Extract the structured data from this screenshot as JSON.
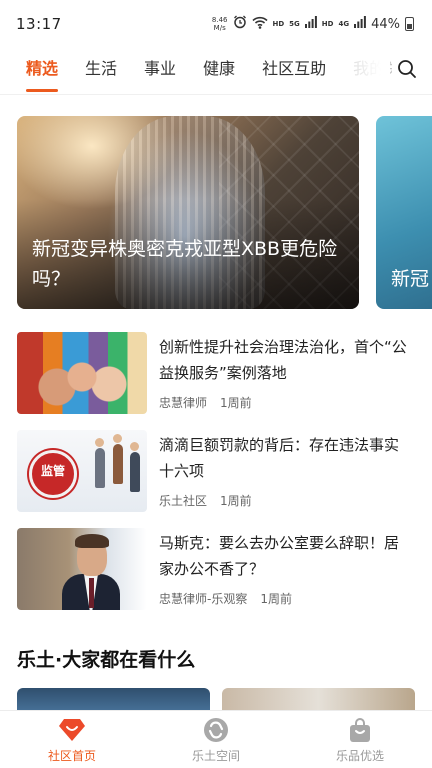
{
  "status_bar": {
    "time": "13:17",
    "net_speed_value": "8.46",
    "net_speed_unit": "M/s",
    "hd1": "HD",
    "signal1": "5G",
    "hd2": "HD",
    "signal2": "4G",
    "battery": "44%"
  },
  "tabs": {
    "items": [
      "精选",
      "生活",
      "事业",
      "健康",
      "社区互助",
      "我的关"
    ],
    "active_index": 0,
    "search_icon": "search-icon"
  },
  "banner": {
    "title": "新冠变异株奥密克戎亚型XBB更危险吗？",
    "next_title": "新冠"
  },
  "news": [
    {
      "title": "创新性提升社会治理法治化，首个“公益换服务”案例落地",
      "author": "忠慧律师",
      "time": "1周前"
    },
    {
      "title": "滴滴巨额罚款的背后：存在违法事实十六项",
      "author": "乐土社区",
      "time": "1周前",
      "thumb_badge": "监管"
    },
    {
      "title": "马斯克：要么去办公室要么辞职！居家办公不香了？",
      "author": "忠慧律师-乐观察",
      "time": "1周前"
    }
  ],
  "section": {
    "title": "乐土·大家都在看什么"
  },
  "bottom_nav": {
    "items": [
      {
        "label": "社区首页",
        "icon": "home-diamond-icon"
      },
      {
        "label": "乐土空间",
        "icon": "space-swirl-icon"
      },
      {
        "label": "乐品优选",
        "icon": "shopping-bag-icon"
      }
    ],
    "active_index": 0
  },
  "colors": {
    "accent": "#ec5a1e",
    "inactive": "#9a9a9a"
  }
}
